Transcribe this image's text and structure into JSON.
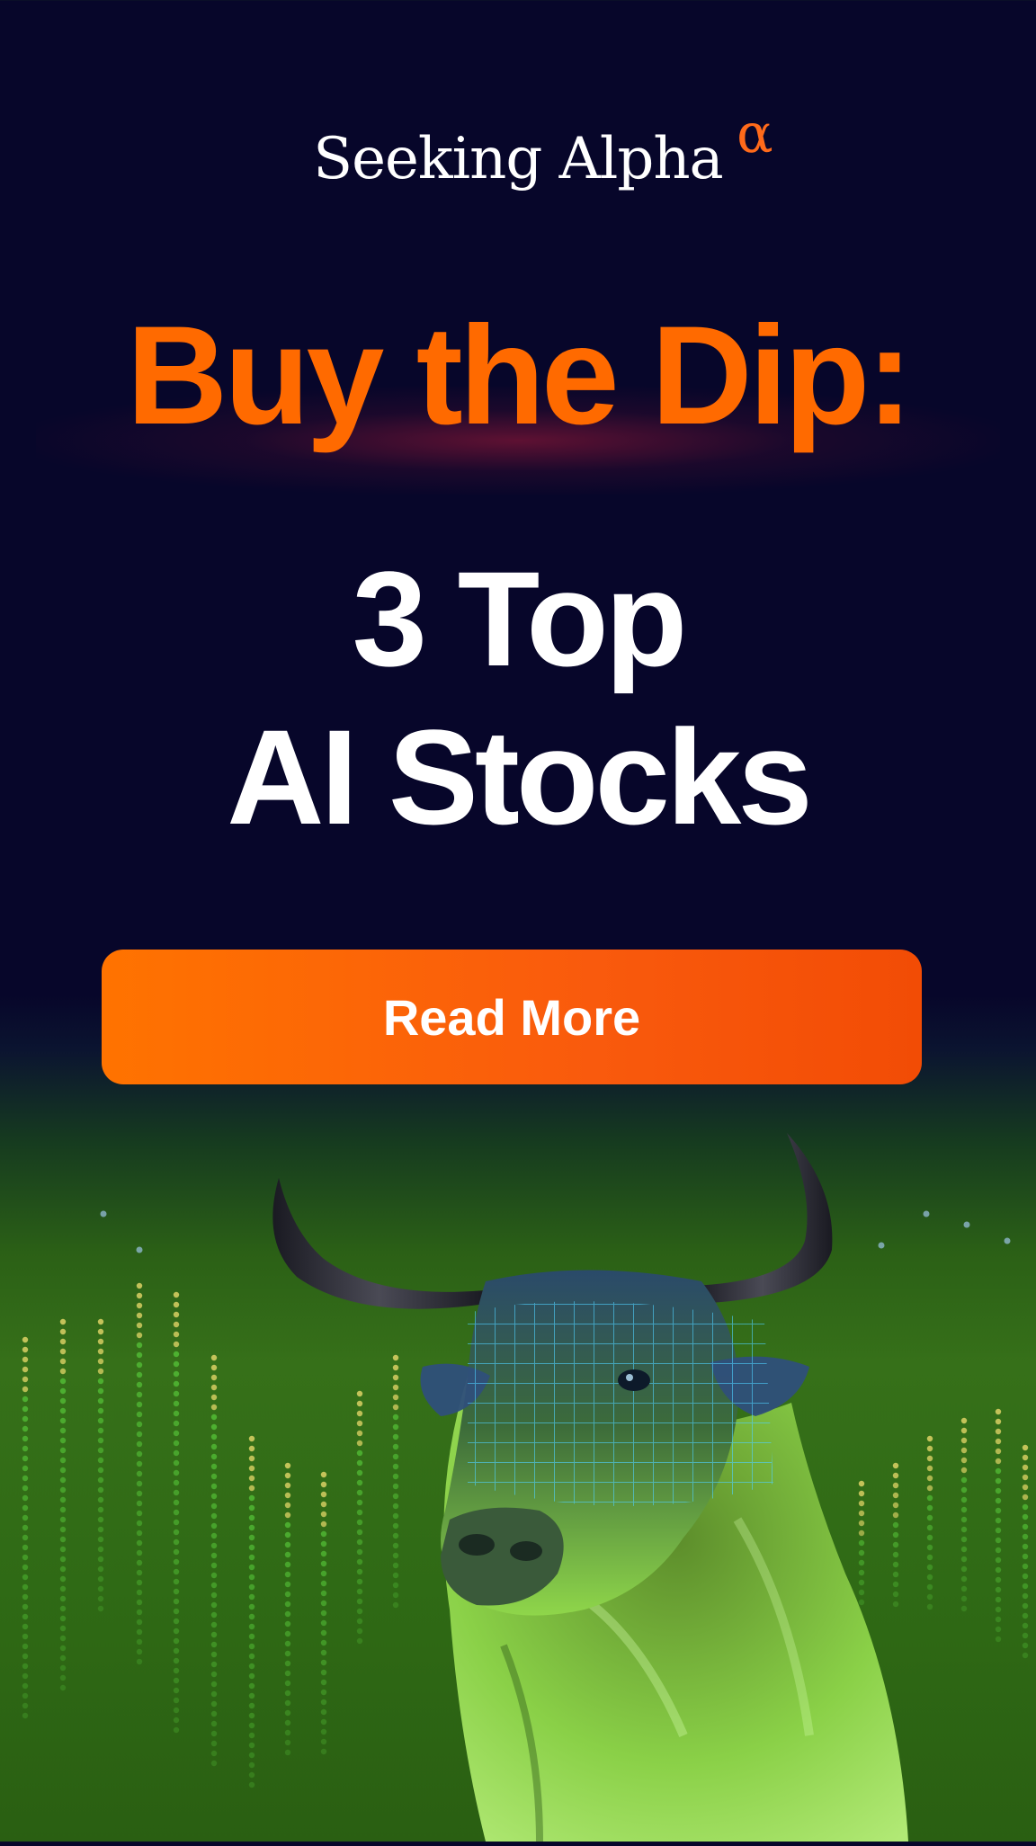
{
  "brand": {
    "logo_text": "Seeking Alpha",
    "logo_symbol": "α",
    "accent_color": "#ff6a00"
  },
  "headline": {
    "line1": "Buy the Dip:",
    "line2a": "3 Top",
    "line2b": "AI Stocks"
  },
  "cta": {
    "label": "Read More"
  },
  "illustration": {
    "subject": "bull-icon",
    "background_color": "#2f6a15"
  }
}
